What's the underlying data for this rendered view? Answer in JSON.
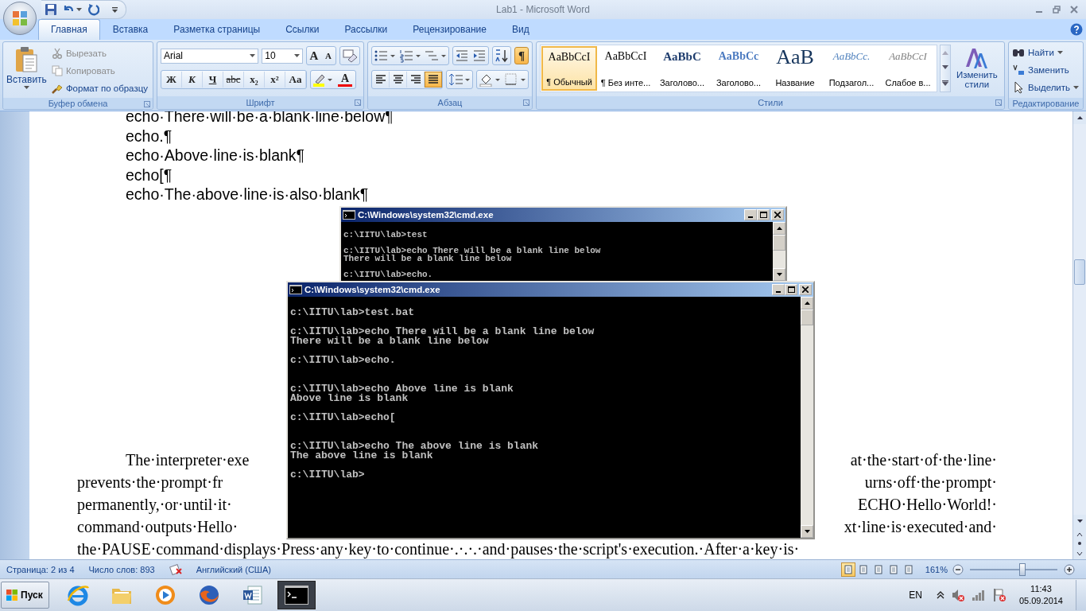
{
  "window": {
    "title": "Lab1 - Microsoft Word"
  },
  "tabs": [
    {
      "label": "Главная",
      "selected": true
    },
    {
      "label": "Вставка",
      "selected": false
    },
    {
      "label": "Разметка страницы",
      "selected": false
    },
    {
      "label": "Ссылки",
      "selected": false
    },
    {
      "label": "Рассылки",
      "selected": false
    },
    {
      "label": "Рецензирование",
      "selected": false
    },
    {
      "label": "Вид",
      "selected": false
    }
  ],
  "ribbon": {
    "clipboard": {
      "label": "Буфер обмена",
      "paste": "Вставить",
      "items": [
        {
          "kind": "cut",
          "label": "Вырезать",
          "disabled": true
        },
        {
          "kind": "copy",
          "label": "Копировать",
          "disabled": true
        },
        {
          "kind": "painter",
          "label": "Формат по образцу",
          "disabled": false
        }
      ]
    },
    "font": {
      "label": "Шрифт",
      "name": "Arial",
      "size": "10",
      "grow": "A",
      "shrink": "A",
      "format_buttons": [
        "Ж",
        "К",
        "Ч",
        "abc",
        "x₂",
        "x²",
        "Aa"
      ],
      "font_color": "A"
    },
    "paragraph": {
      "label": "Абзац",
      "show_marks": {
        "label": "¶",
        "on": true
      },
      "alignments": [
        {
          "kind": "left",
          "selected": false
        },
        {
          "kind": "center",
          "selected": false
        },
        {
          "kind": "right",
          "selected": false
        },
        {
          "kind": "justify",
          "selected": true
        }
      ]
    },
    "styles": {
      "label": "Стили",
      "change": "Изменить стили",
      "items": [
        {
          "kind": "normal",
          "preview": "AaBbCcI",
          "name": "¶ Обычный",
          "selected": true
        },
        {
          "kind": "nospacing",
          "preview": "AaBbCcI",
          "name": "¶ Без инте...",
          "selected": false
        },
        {
          "kind": "heading1",
          "preview": "AaBbC",
          "name": "Заголово...",
          "selected": false
        },
        {
          "kind": "heading2",
          "preview": "AaBbCc",
          "name": "Заголово...",
          "selected": false
        },
        {
          "kind": "title",
          "preview": "AaB",
          "name": "Название",
          "selected": false
        },
        {
          "kind": "subtitle",
          "preview": "AaBbCc.",
          "name": "Подзагол...",
          "selected": false
        },
        {
          "kind": "subtle",
          "preview": "AaBbCcI",
          "name": "Слабое в...",
          "selected": false
        }
      ]
    },
    "editing": {
      "label": "Редактирование",
      "items": [
        {
          "kind": "find",
          "label": "Найти"
        },
        {
          "kind": "replace",
          "label": "Заменить"
        },
        {
          "kind": "select",
          "label": "Выделить"
        }
      ]
    }
  },
  "document": {
    "code_lines": [
      "echo·There·will·be·a·blank·line·below¶",
      "echo.¶",
      "echo·Above·line·is·blank¶",
      "echo[¶",
      "echo·The·above·line·is·also·blank¶"
    ],
    "paragraph_lines": [
      {
        "left": "The·interpreter·exe",
        "right": "at·the·start·of·the·line·"
      },
      {
        "left": "prevents·the·prompt·fr",
        "right": "urns·off·the·prompt·"
      },
      {
        "left": "permanently,·or·until·it·",
        "right": "ECHO·Hello·World!·"
      },
      {
        "left": "command·outputs·Hello·",
        "right": "xt·line·is·executed·and·"
      },
      {
        "left": "the·PAUSE·command·displays·Press·any·key·to·continue·.·.·.·and·pauses·the·script's·execution.·After·a·key·is·"
      }
    ]
  },
  "consoles": [
    {
      "title": "C:\\Windows\\system32\\cmd.exe",
      "entries": [
        {
          "kind": "command",
          "command": "c:\\IITU\\lab>test"
        },
        {
          "kind": "command",
          "command": "c:\\IITU\\lab>echo There will be a blank line below",
          "output": [
            "There will be a blank line below"
          ]
        },
        {
          "kind": "command",
          "command": "c:\\IITU\\lab>echo."
        }
      ]
    },
    {
      "title": "C:\\Windows\\system32\\cmd.exe",
      "entries": [
        {
          "kind": "command",
          "command": "c:\\IITU\\lab>test.bat"
        },
        {
          "kind": "command",
          "command": "c:\\IITU\\lab>echo There will be a blank line below",
          "output": [
            "There will be a blank line below"
          ]
        },
        {
          "kind": "blank_echo",
          "command": "c:\\IITU\\lab>echo."
        },
        {
          "kind": "command",
          "command": "c:\\IITU\\lab>echo Above line is blank",
          "output": [
            "Above line is blank"
          ]
        },
        {
          "kind": "blank_echo",
          "command": "c:\\IITU\\lab>echo["
        },
        {
          "kind": "command",
          "command": "c:\\IITU\\lab>echo The above line is blank",
          "output": [
            "The above line is blank"
          ]
        },
        {
          "kind": "prompt",
          "command": "c:\\IITU\\lab>"
        }
      ]
    }
  ],
  "status_bar": {
    "page": "Страница: 2 из 4",
    "words": "Число слов: 893",
    "language": "Английский (США)",
    "views": [
      {
        "selected": true
      },
      {
        "selected": false
      },
      {
        "selected": false
      },
      {
        "selected": false
      },
      {
        "selected": false
      }
    ],
    "zoom": "161%",
    "zoom_slider": {
      "level": 0.6
    }
  },
  "taskbar": {
    "start": "Пуск",
    "apps": [
      {
        "kind": "browser",
        "selected": false
      },
      {
        "kind": "folder",
        "selected": false
      },
      {
        "kind": "media",
        "selected": false
      },
      {
        "kind": "firefox",
        "selected": false
      },
      {
        "kind": "word",
        "selected": false
      },
      {
        "kind": "console",
        "selected": true
      }
    ],
    "language": "EN",
    "time": "11:43",
    "date": "05.09.2014"
  }
}
